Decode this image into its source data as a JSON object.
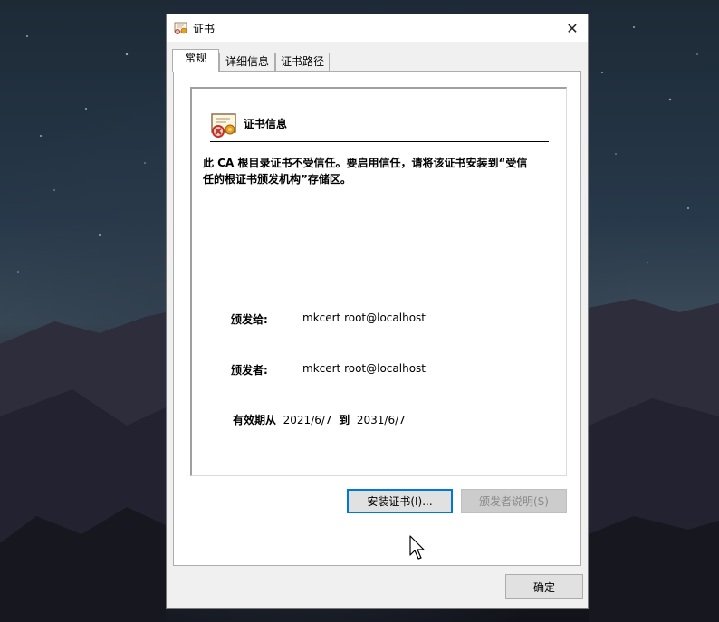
{
  "window": {
    "title": "证书"
  },
  "tabs": [
    {
      "label": "常规",
      "active": true
    },
    {
      "label": "详细信息",
      "active": false
    },
    {
      "label": "证书路径",
      "active": false
    }
  ],
  "general": {
    "section_title": "证书信息",
    "warning_line1": "此 CA 根目录证书不受信任。要启用信任，请将该证书安装到“受信",
    "warning_line2": "任的根证书颁发机构”存储区。",
    "issued_to_label": "颁发给:",
    "issued_to_value": "mkcert root@localhost",
    "issued_by_label": "颁发者:",
    "issued_by_value": "mkcert root@localhost",
    "validity_from_label": "有效期从",
    "validity_from": "2021/6/7",
    "validity_to_label": "到",
    "validity_to": "2031/6/7"
  },
  "buttons": {
    "install": "安装证书(I)...",
    "issuer_statement": "颁发者说明(S)",
    "ok": "确定"
  },
  "icons": {
    "title": "certificate-icon",
    "section": "certificate-icon",
    "close": "close-icon"
  }
}
